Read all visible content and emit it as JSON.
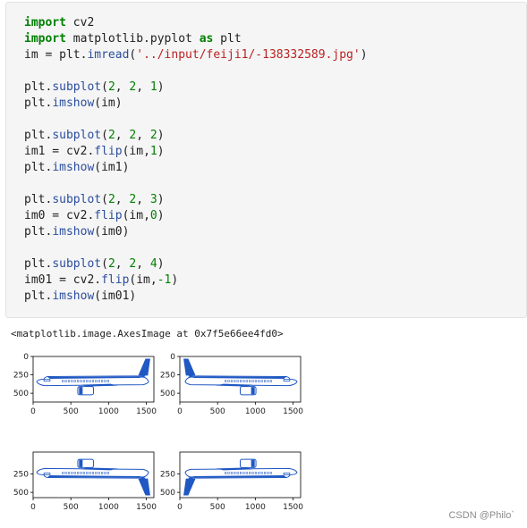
{
  "code": {
    "lines": [
      [
        [
          "kw",
          "import"
        ],
        [
          "t",
          " cv2"
        ]
      ],
      [
        [
          "kw",
          "import"
        ],
        [
          "t",
          " matplotlib.pyplot "
        ],
        [
          "kw",
          "as"
        ],
        [
          "t",
          " plt"
        ]
      ],
      [
        [
          "t",
          "im = plt."
        ],
        [
          "fn",
          "imread"
        ],
        [
          "t",
          "("
        ],
        [
          "str",
          "'../input/feiji1/-138332589.jpg'"
        ],
        [
          "t",
          ")"
        ]
      ],
      [],
      [
        [
          "t",
          "plt."
        ],
        [
          "fn",
          "subplot"
        ],
        [
          "t",
          "("
        ],
        [
          "num",
          "2"
        ],
        [
          "t",
          ", "
        ],
        [
          "num",
          "2"
        ],
        [
          "t",
          ", "
        ],
        [
          "num",
          "1"
        ],
        [
          "t",
          ")"
        ]
      ],
      [
        [
          "t",
          "plt."
        ],
        [
          "fn",
          "imshow"
        ],
        [
          "t",
          "(im)"
        ]
      ],
      [],
      [
        [
          "t",
          "plt."
        ],
        [
          "fn",
          "subplot"
        ],
        [
          "t",
          "("
        ],
        [
          "num",
          "2"
        ],
        [
          "t",
          ", "
        ],
        [
          "num",
          "2"
        ],
        [
          "t",
          ", "
        ],
        [
          "num",
          "2"
        ],
        [
          "t",
          ")"
        ]
      ],
      [
        [
          "t",
          "im1 = cv2."
        ],
        [
          "fn",
          "flip"
        ],
        [
          "t",
          "(im,"
        ],
        [
          "num",
          "1"
        ],
        [
          "t",
          ")"
        ]
      ],
      [
        [
          "t",
          "plt."
        ],
        [
          "fn",
          "imshow"
        ],
        [
          "t",
          "(im1)"
        ]
      ],
      [],
      [
        [
          "t",
          "plt."
        ],
        [
          "fn",
          "subplot"
        ],
        [
          "t",
          "("
        ],
        [
          "num",
          "2"
        ],
        [
          "t",
          ", "
        ],
        [
          "num",
          "2"
        ],
        [
          "t",
          ", "
        ],
        [
          "num",
          "3"
        ],
        [
          "t",
          ")"
        ]
      ],
      [
        [
          "t",
          "im0 = cv2."
        ],
        [
          "fn",
          "flip"
        ],
        [
          "t",
          "(im,"
        ],
        [
          "num",
          "0"
        ],
        [
          "t",
          ")"
        ]
      ],
      [
        [
          "t",
          "plt."
        ],
        [
          "fn",
          "imshow"
        ],
        [
          "t",
          "(im0)"
        ]
      ],
      [],
      [
        [
          "t",
          "plt."
        ],
        [
          "fn",
          "subplot"
        ],
        [
          "t",
          "("
        ],
        [
          "num",
          "2"
        ],
        [
          "t",
          ", "
        ],
        [
          "num",
          "2"
        ],
        [
          "t",
          ", "
        ],
        [
          "num",
          "4"
        ],
        [
          "t",
          ")"
        ]
      ],
      [
        [
          "t",
          "im01 = cv2."
        ],
        [
          "fn",
          "flip"
        ],
        [
          "t",
          "(im,"
        ],
        [
          "num",
          "-1"
        ],
        [
          "t",
          ")"
        ]
      ],
      [
        [
          "t",
          "plt."
        ],
        [
          "fn",
          "imshow"
        ],
        [
          "t",
          "(im01)"
        ]
      ]
    ]
  },
  "output": {
    "text": "<matplotlib.image.AxesImage at 0x7f5e66ee4fd0>"
  },
  "figure": {
    "subplots": [
      {
        "name": "subplot-original",
        "flip": "none"
      },
      {
        "name": "subplot-flip-horizontal",
        "flip": "horizontal"
      },
      {
        "name": "subplot-flip-vertical",
        "flip": "vertical"
      },
      {
        "name": "subplot-flip-both",
        "flip": "both"
      }
    ],
    "x_ticks": [
      "0",
      "500",
      "1000",
      "1500"
    ],
    "y_ticks": [
      "0",
      "250",
      "500"
    ],
    "y_ticks_bottom": [
      "250",
      "500"
    ],
    "plane_colors": {
      "body": "#ffffff",
      "accent": "#1f57c3",
      "outline": "#1f57c3"
    }
  },
  "watermark": "CSDN @Philo`"
}
